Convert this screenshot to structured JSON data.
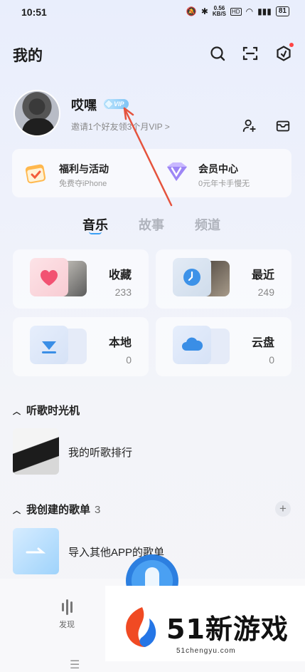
{
  "status": {
    "time": "10:51",
    "speed_top": "0.56",
    "speed_unit": "KB/S",
    "hd": "HD",
    "battery": "81"
  },
  "header": {
    "title": "我的",
    "icons": [
      "search-icon",
      "scan-icon",
      "settings-hexagon-icon"
    ]
  },
  "profile": {
    "name": "哎嘿",
    "vip_badge": "VIP",
    "invite_text": "邀请1个好友领3个月VIP >"
  },
  "promos": [
    {
      "title": "福利与活动",
      "subtitle": "免费夺iPhone"
    },
    {
      "title": "会员中心",
      "subtitle": "0元年卡手慢无"
    }
  ],
  "tabs": [
    {
      "label": "音乐",
      "active": true
    },
    {
      "label": "故事",
      "active": false
    },
    {
      "label": "频道",
      "active": false
    }
  ],
  "tiles": [
    {
      "title": "收藏",
      "count": "233"
    },
    {
      "title": "最近",
      "count": "249"
    },
    {
      "title": "本地",
      "count": "0"
    },
    {
      "title": "云盘",
      "count": "0"
    }
  ],
  "sections": {
    "history": {
      "title": "听歌时光机",
      "row_label": "我的听歌排行"
    },
    "created": {
      "title": "我创建的歌单",
      "count": "3",
      "row_label": "导入其他APP的歌单"
    }
  },
  "bottom_nav": {
    "discover_label": "发现"
  },
  "watermark": {
    "text": "51新游戏",
    "url": "51chengyu.com"
  },
  "colors": {
    "accent": "#3aa0f5",
    "annotation_arrow": "#e5533d"
  }
}
